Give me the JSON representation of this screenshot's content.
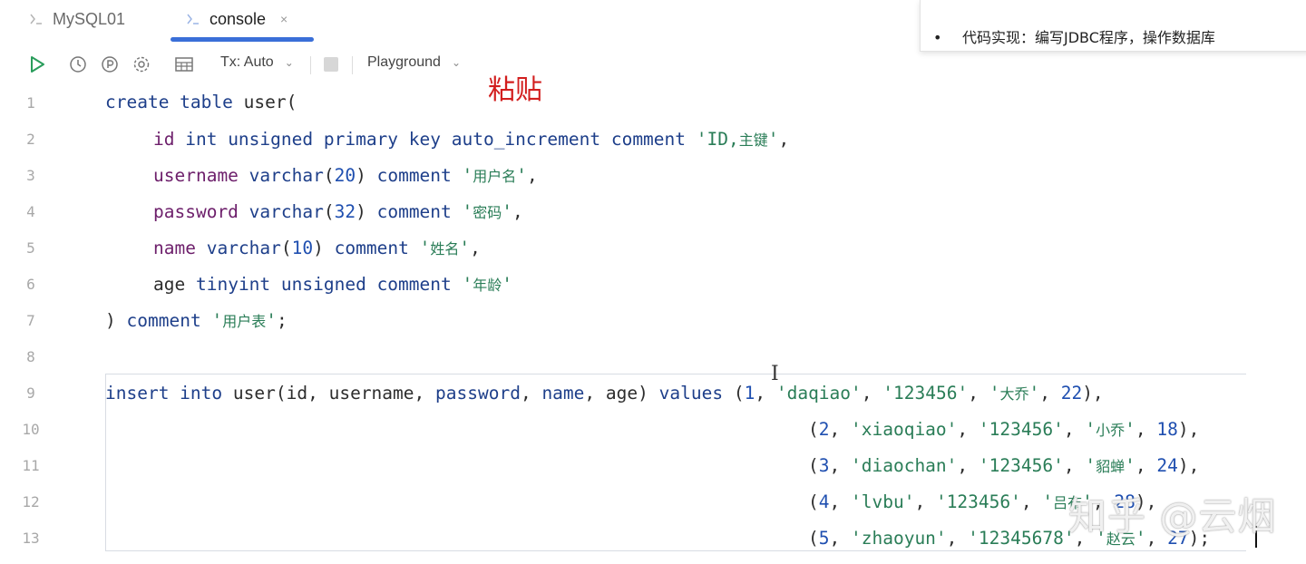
{
  "tabs": [
    {
      "label": "MySQL01"
    },
    {
      "label": "console",
      "close": "×",
      "active": true
    }
  ],
  "toolbar": {
    "tx_label": "Tx: Auto",
    "playground_label": "Playground"
  },
  "annotation": "粘贴",
  "popup": {
    "line2": "代码实现：编写JDBC程序，操作数据库"
  },
  "editor": {
    "line_numbers": [
      "1",
      "2",
      "3",
      "4",
      "5",
      "6",
      "7",
      "8",
      "9",
      "10",
      "11",
      "12",
      "13"
    ]
  },
  "watermark": "知乎 @云烟"
}
